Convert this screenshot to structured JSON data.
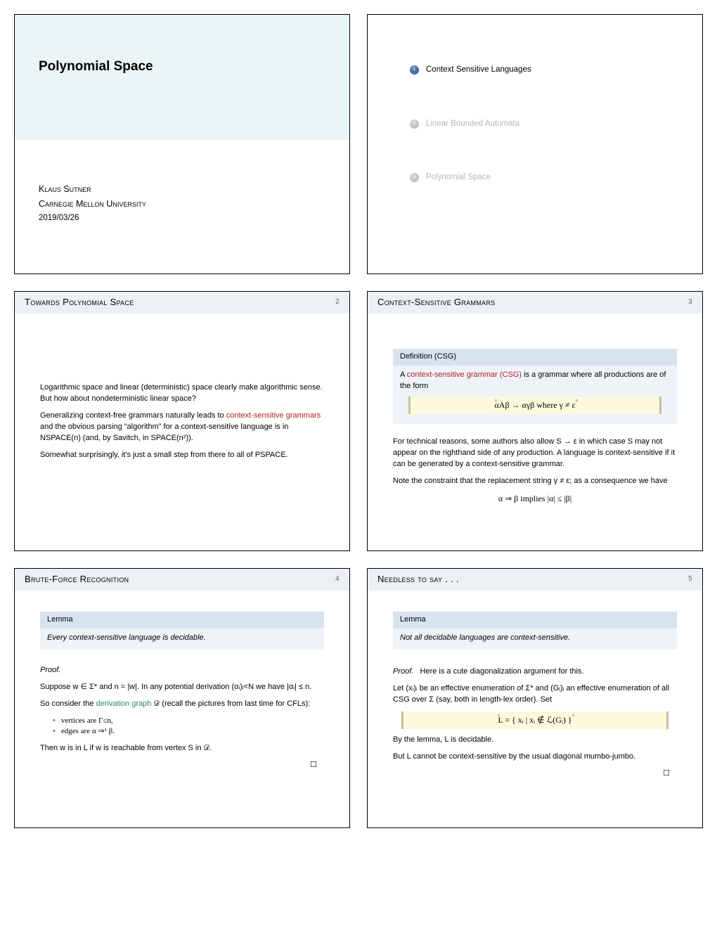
{
  "title_slide": {
    "title": "Polynomial Space",
    "author": "Klaus Sutner",
    "affiliation": "Carnegie Mellon University",
    "date": "2019/03/26"
  },
  "outline": {
    "items": [
      {
        "num": "1",
        "label": "Context Sensitive Languages",
        "active": true
      },
      {
        "num": "2",
        "label": "Linear Bounded Automata",
        "active": false
      },
      {
        "num": "3",
        "label": "Polynomial Space",
        "active": false
      }
    ]
  },
  "slide2": {
    "title": "Towards Polynomial Space",
    "number": "2",
    "p1": "Logarithmic space and linear (deterministic) space clearly make algorithmic sense. But how about nondeterministic linear space?",
    "p2a": "Generalizing context-free grammars naturally leads to ",
    "p2b": "context-sensitive grammars",
    "p2c": " and the obvious parsing “algorithm” for a context-sensitive language is in NSPACE(n) (and, by Savitch, in SPACE(n²)).",
    "p3": "Somewhat surprisingly, it's just a small step from there to all of PSPACE."
  },
  "slide3": {
    "title": "Context-Sensitive Grammars",
    "number": "3",
    "def_head": "Definition (CSG)",
    "def_a": "A ",
    "def_b": "context-sensitive grammar (CSG)",
    "def_c": " is a grammar where all productions are of the form",
    "formula": "αAβ → αγβ      where γ ≠ ε",
    "p1": "For technical reasons, some authors also allow S → ε in which case S may not appear on the righthand side of any production. A language is context-sensitive if it can be generated by a context-sensitive grammar.",
    "p2": "Note the constraint that the replacement string γ ≠ ε; as a consequence we have",
    "formula2": "α ⇒ β        implies        |α| ≤ |β|"
  },
  "slide4": {
    "title": "Brute-Force Recognition",
    "number": "4",
    "lemma_head": "Lemma",
    "lemma_body": "Every context-sensitive language is decidable.",
    "proof_label": "Proof.",
    "p1": "Suppose w ∈ Σ* and n = |w|. In any potential derivation (αᵢ)ᵢ<N we have |αᵢ| ≤ n.",
    "p2a": "So consider the ",
    "p2b": "derivation graph",
    "p2c": " 𝒟 (recall the pictures from last time for CFLs):",
    "b1": "vertices are Γ≤n,",
    "b2": "edges are α ⇒¹ β.",
    "p3": "Then w is in L if w is reachable from vertex S in 𝒟.",
    "qed": "☐"
  },
  "slide5": {
    "title": "Needless to say . . .",
    "number": "5",
    "lemma_head": "Lemma",
    "lemma_body": "Not all decidable languages are context-sensitive.",
    "proof_label": "Proof.",
    "p1": "Here is a cute diagonalization argument for this.",
    "p2": "Let (xᵢ)ᵢ be an effective enumeration of Σ* and (Gᵢ)ᵢ an effective enumeration of all CSG over Σ (say, both in length-lex order). Set",
    "formula": "L = { xᵢ | xᵢ ∉ ℒ(Gᵢ) }",
    "p3": "By the lemma, L is decidable.",
    "p4": "But L cannot be context-sensitive by the usual diagonal mumbo-jumbo.",
    "qed": "☐"
  }
}
